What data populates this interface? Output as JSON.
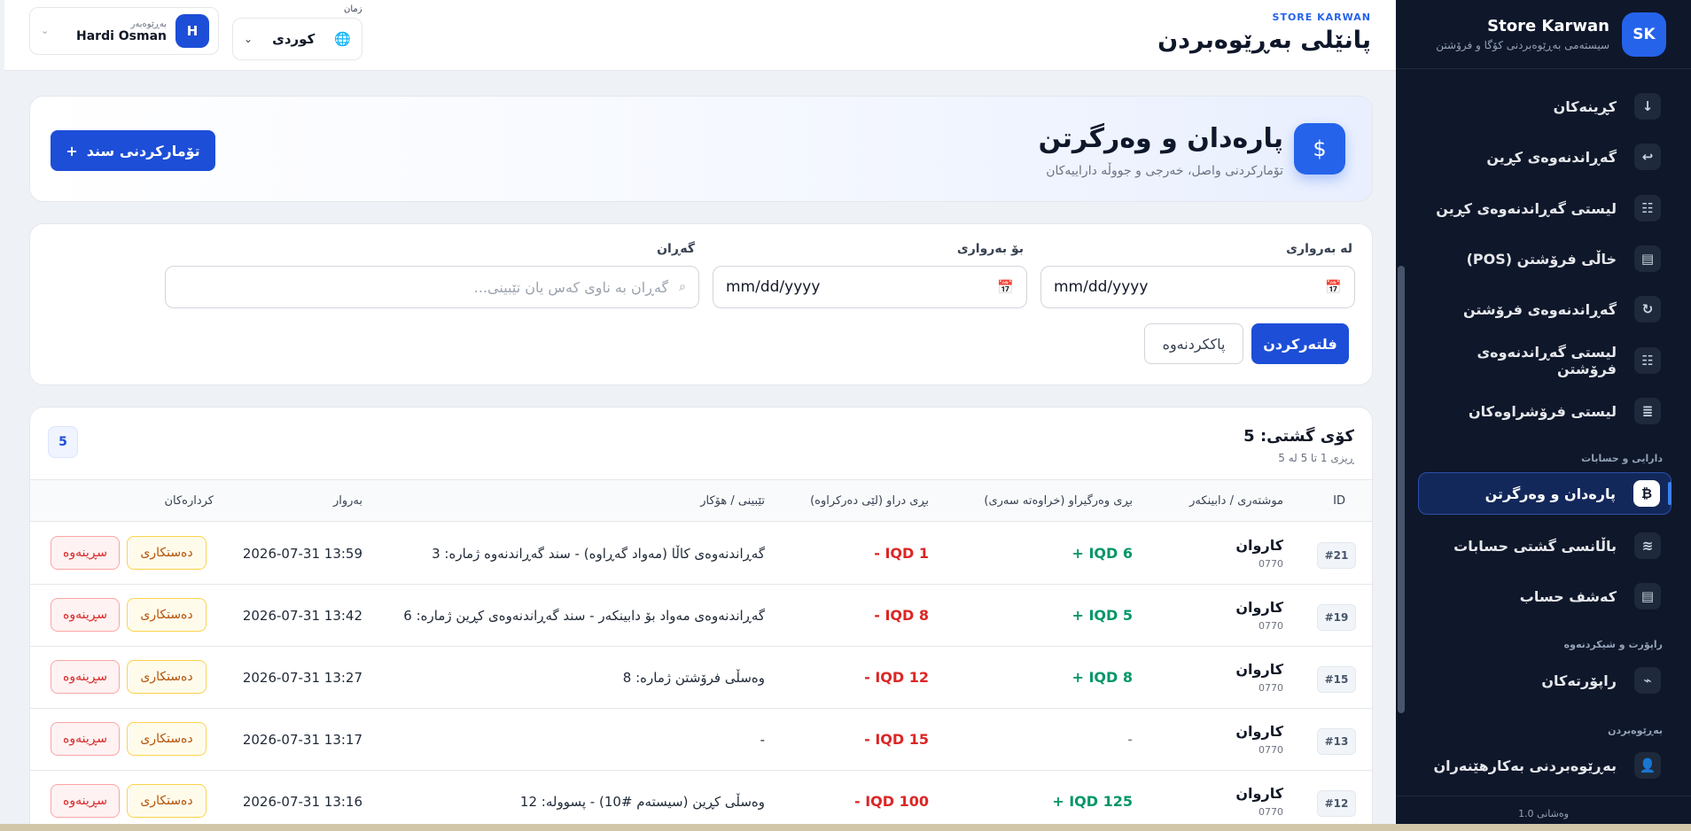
{
  "sidebar": {
    "logo": "SK",
    "brand": "Store Karwan",
    "subtitle": "سیستەمی بەڕێوەبردنی کۆگا و فرۆشتن",
    "items": [
      {
        "label": "کڕینەکان",
        "icon": "↓"
      },
      {
        "label": "گەڕاندنەوەی کڕین",
        "icon": "↩"
      },
      {
        "label": "لیستی گەڕاندنەوەی کڕین",
        "icon": "☷"
      },
      {
        "label": "خاڵی فرۆشتن (POS)",
        "icon": "▤"
      },
      {
        "label": "گەڕاندنەوەی فرۆشتن",
        "icon": "↻"
      },
      {
        "label": "لیستی گەڕاندنەوەی فرۆشتن",
        "icon": "☷"
      },
      {
        "label": "لیستی فرۆشراوەکان",
        "icon": "≣"
      },
      {
        "label": "پارەدان و وەرگرتن",
        "icon": "₿"
      },
      {
        "label": "باڵانسی گشتی حسابات",
        "icon": "≋"
      },
      {
        "label": "کەشف حساب",
        "icon": "▤"
      },
      {
        "label": "راپۆرتەکان",
        "icon": "⌁"
      },
      {
        "label": "بەڕێوەبردنی بەکارهێنەران",
        "icon": "👤"
      }
    ],
    "sections": {
      "finance": "دارایی و حسابات",
      "reports": "راپۆرت و شیکردنەوە",
      "management": "بەڕێوەبردن"
    },
    "version": "وەشانی 1.0"
  },
  "topbar": {
    "brand": "STORE KARWAN",
    "title": "پانێلی بەڕێوەبردن",
    "language_label": "زمان",
    "language_value": "كوردی",
    "user_role": "بەڕێوەبەر",
    "user_name": "Hardi Osman",
    "user_initial": "H"
  },
  "hero": {
    "icon": "$",
    "title": "پارەدان و وەرگرتن",
    "subtitle": "تۆمارکردنی واصل، خەرجی و جووڵە داراییەکان",
    "add_button": "تۆمارکردنی سند",
    "add_icon": "+"
  },
  "filters": {
    "from_label": "لە بەرواری",
    "to_label": "بۆ بەرواری",
    "search_label": "گەڕان",
    "from_value": "mm/dd/yyyy",
    "to_value": "mm/dd/yyyy",
    "search_placeholder": "گەڕان بە ناوی کەس یان تێبینی...",
    "filter_button": "فلتەرکردن",
    "clear_button": "پاککردنەوە"
  },
  "table": {
    "total_label": "کۆی گشتی: 5",
    "range_label": "ڕیزی 1 تا 5 لە 5",
    "count_badge": "5",
    "headers": {
      "id": "ID",
      "party": "موشتەری / دابینکەر",
      "received": "بڕی وەرگیراو (خراوەتە سەری)",
      "paid": "بڕی دراو (لێی دەرکراوە)",
      "note": "تێبینی / هۆکار",
      "date": "بەروار",
      "actions": "کردارەکان"
    },
    "edit_label": "دەستکاری",
    "delete_label": "سڕینەوە",
    "rows": [
      {
        "id": "#21",
        "name": "کاروان",
        "code": "0770",
        "received": "+ IQD 6",
        "paid": "- IQD 1",
        "note": "گەڕاندنەوەی کاڵا (مەواد گەڕاوە) - سند گەڕاندنەوە ژمارە: 3",
        "date": "2026-07-31 13:59"
      },
      {
        "id": "#19",
        "name": "کاروان",
        "code": "0770",
        "received": "+ IQD 5",
        "paid": "- IQD 8",
        "note": "گەڕاندنەوەی مەواد بۆ دابینکەر - سند گەڕاندنەوەی کڕین ژمارە: 6",
        "date": "2026-07-31 13:42"
      },
      {
        "id": "#15",
        "name": "کاروان",
        "code": "0770",
        "received": "+ IQD 8",
        "paid": "- IQD 12",
        "note": "وەسڵی فرۆشتن ژمارە: 8",
        "date": "2026-07-31 13:27"
      },
      {
        "id": "#13",
        "name": "کاروان",
        "code": "0770",
        "received": "-",
        "paid": "- IQD 15",
        "note": "-",
        "date": "2026-07-31 13:17"
      },
      {
        "id": "#12",
        "name": "کاروان",
        "code": "0770",
        "received": "+ IQD 125",
        "paid": "- IQD 100",
        "note": "وەسڵی کڕین (سیستەم #10) - پسوولە: 12",
        "date": "2026-07-31 13:16"
      }
    ]
  },
  "colors": {
    "accent": "#2563eb",
    "sidebar_bg": "#0f172a",
    "received": "#059669",
    "paid": "#dc2626"
  }
}
